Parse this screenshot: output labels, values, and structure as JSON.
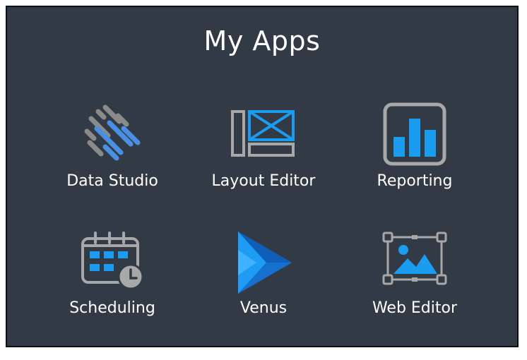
{
  "header": {
    "title": "My Apps"
  },
  "apps": [
    {
      "label": "Data Studio",
      "icon": "data-studio-icon"
    },
    {
      "label": "Layout Editor",
      "icon": "layout-editor-icon"
    },
    {
      "label": "Reporting",
      "icon": "bar-chart-icon"
    },
    {
      "label": "Scheduling",
      "icon": "calendar-clock-icon"
    },
    {
      "label": "Venus",
      "icon": "play-triangle-icon"
    },
    {
      "label": "Web Editor",
      "icon": "image-editor-icon"
    }
  ],
  "colors": {
    "background": "#323a46",
    "accent_blue": "#1a9cf0",
    "icon_gray": "#a8a8a8",
    "text": "#ffffff"
  }
}
